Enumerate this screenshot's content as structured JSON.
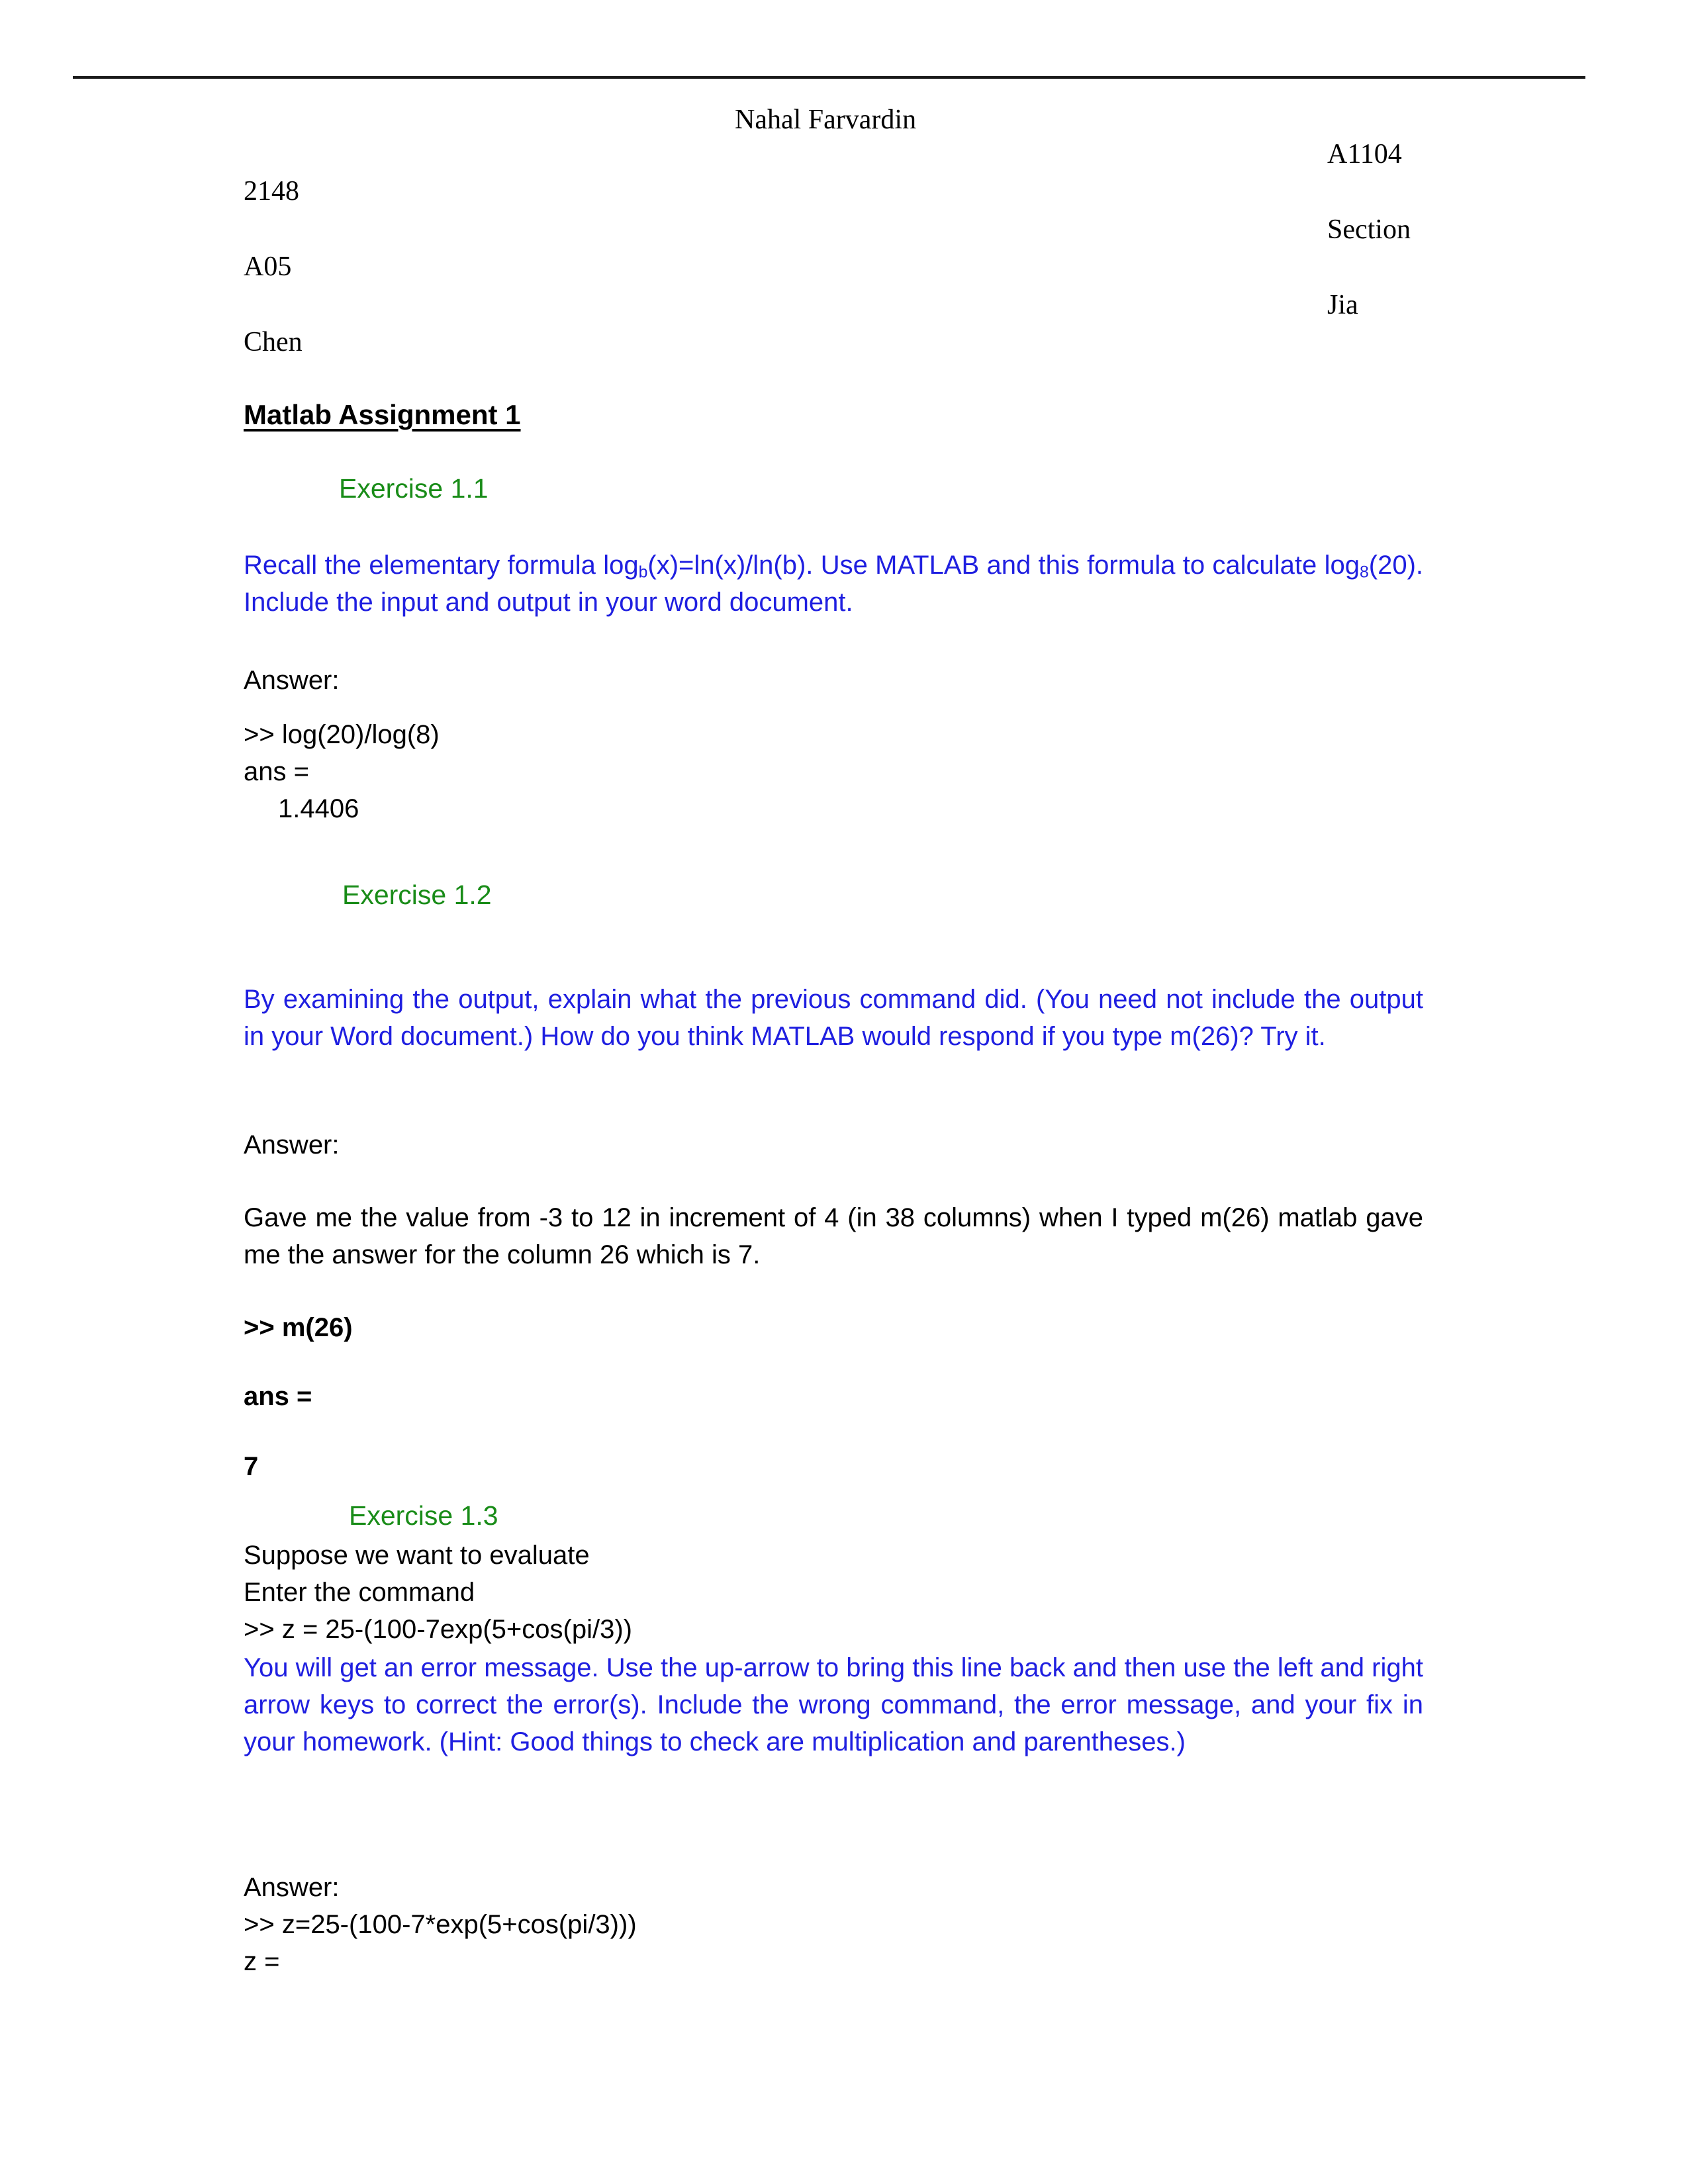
{
  "header": {
    "student_name": "Nahal Farvardin",
    "course_code": "A1104",
    "student_id": "2148",
    "section_label": "Section",
    "section_code": "A05",
    "instructor_first": "Jia",
    "instructor_last": "Chen"
  },
  "document": {
    "title": "Matlab Assignment 1"
  },
  "colors": {
    "exercise_heading": "#198c18",
    "question_text": "#1f1fe0",
    "body_text": "#000000",
    "rule": "#1a1a1a"
  },
  "exercises": [
    {
      "heading": "Exercise 1.1",
      "question_parts": {
        "a": "Recall the elementary formula log",
        "sub1": "b",
        "b": "(x)=ln(x)/ln(b). Use MATLAB and   this formula to calculate log",
        "sub2": "8",
        "c": "(20). Include the input and output in your word document."
      },
      "answer_label": "Answer:",
      "console": [
        ">> log(20)/log(8)",
        "ans =",
        "1.4406"
      ]
    },
    {
      "heading": "Exercise 1.2",
      "question": "By examining the output, explain what the previous command did. (You need not include the output in your Word document.) How do you think MATLAB would respond if you type m(26)? Try it.",
      "answer_label": "Answer:",
      "answer_body": "Gave me the value from -3 to 12 in increment of 4 (in 38 columns) when I typed m(26) matlab gave me the answer for the column 26 which is 7.",
      "console_bold": [
        ">> m(26)",
        "ans =",
        "7"
      ]
    },
    {
      "heading": "Exercise 1.3",
      "question_lines": [
        "Suppose we want to evaluate",
        "Enter the command",
        ">> z = 25-(100-7exp(5+cos(pi/3))"
      ],
      "question_paragraph": "You will get an error message.  Use the up-arrow to bring this line back and then use the left and right arrow keys to correct the error(s). Include the wrong command, the error message, and your fix in your homework.  (Hint: Good things to check are multiplication and parentheses.)",
      "answer_label": "Answer:",
      "console": [
        ">> z=25-(100-7*exp(5+cos(pi/3)))",
        "z ="
      ]
    }
  ]
}
